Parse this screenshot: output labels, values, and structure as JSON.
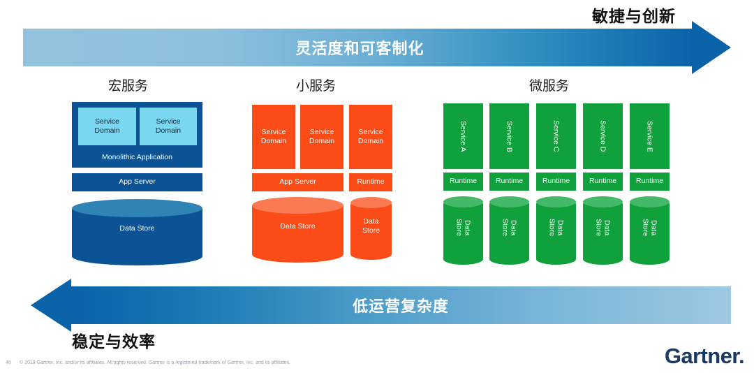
{
  "slide": {
    "top_arrow_label": "灵活度和可客制化",
    "top_right_caption": "敏捷与创新",
    "bottom_arrow_label": "低运营复杂度",
    "bottom_left_caption": "稳定与效率"
  },
  "columns": [
    {
      "key": "macroservices",
      "title": "宏服务",
      "color": "#0B5394",
      "accent": "#7ad7f0",
      "service_domains": [
        "Service\nDomain",
        "Service\nDomain"
      ],
      "container_label": "Monolithic Application",
      "app_server_label": "App Server",
      "data_store_label": "Data Store"
    },
    {
      "key": "miniservices",
      "title": "小服务",
      "color": "#fb4b16",
      "service_domains": [
        "Service\nDomain",
        "Service\nDomain",
        "Service\nDomain"
      ],
      "app_server_label": "App Server",
      "runtime_label": "Runtime",
      "data_store_label_wide": "Data Store",
      "data_store_label_narrow": "Data\nStore"
    },
    {
      "key": "microservices",
      "title": "微服务",
      "color": "#10a13d",
      "services": [
        "Service A",
        "Service B",
        "Service C",
        "Service D",
        "Service E"
      ],
      "runtime_labels": [
        "Runtime",
        "Runtime",
        "Runtime",
        "Runtime",
        "Runtime"
      ],
      "data_store_labels": [
        "Data\nStore",
        "Data\nStore",
        "Data\nStore",
        "Data\nStore",
        "Data\nStore"
      ]
    }
  ],
  "footer": {
    "page_number": "48",
    "copyright": "© 2019 Gartner, Inc. and/or its affiliates. All rights reserved. Gartner is a registered trademark of Gartner, Inc. and its affiliates.",
    "logo_text": "Gartner",
    "logo_mark": "."
  },
  "colors": {
    "arrow_light": "#93c2de",
    "arrow_dark": "#0a62a9",
    "blue": "#0B5394",
    "light_blue": "#7ad7f0",
    "orange": "#fb4b16",
    "green": "#10a13d",
    "logo_navy": "#1b3a63"
  }
}
